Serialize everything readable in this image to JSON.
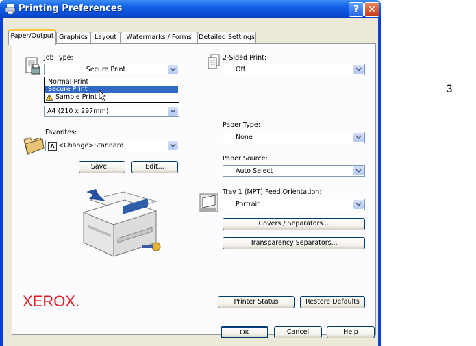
{
  "window": {
    "title": "Printing Preferences",
    "help": "?",
    "close": "✕"
  },
  "tabs": [
    "Paper/Output",
    "Graphics",
    "Layout",
    "Watermarks / Forms",
    "Detailed Settings"
  ],
  "job_type": {
    "label": "Job Type:",
    "value": "Secure Print",
    "options": [
      "Normal Print",
      "Secure Print",
      "Sample Print"
    ],
    "selected_index": 1
  },
  "paper_size": {
    "value": "A4 (210 x 297mm)"
  },
  "two_sided": {
    "label": "2-Sided Print:",
    "value": "Off"
  },
  "favorites": {
    "label": "Favorites:",
    "value": "<Change>Standard",
    "badge": "A"
  },
  "buttons": {
    "save": "Save...",
    "edit": "Edit...",
    "covers": "Covers / Separators...",
    "transparency": "Transparency Separators...",
    "printer_status": "Printer Status",
    "restore": "Restore Defaults",
    "ok": "OK",
    "cancel": "Cancel",
    "help": "Help"
  },
  "paper_type": {
    "label": "Paper Type:",
    "value": "None"
  },
  "paper_source": {
    "label": "Paper Source:",
    "value": "Auto Select"
  },
  "tray_orientation": {
    "label": "Tray 1 (MPT) Feed Orientation:",
    "value": "Portrait"
  },
  "brand": "XEROX.",
  "callout": "3",
  "colors": {
    "accent": "#316ac5",
    "brand": "#e11b22",
    "titlebar": "#0a4cd6"
  }
}
